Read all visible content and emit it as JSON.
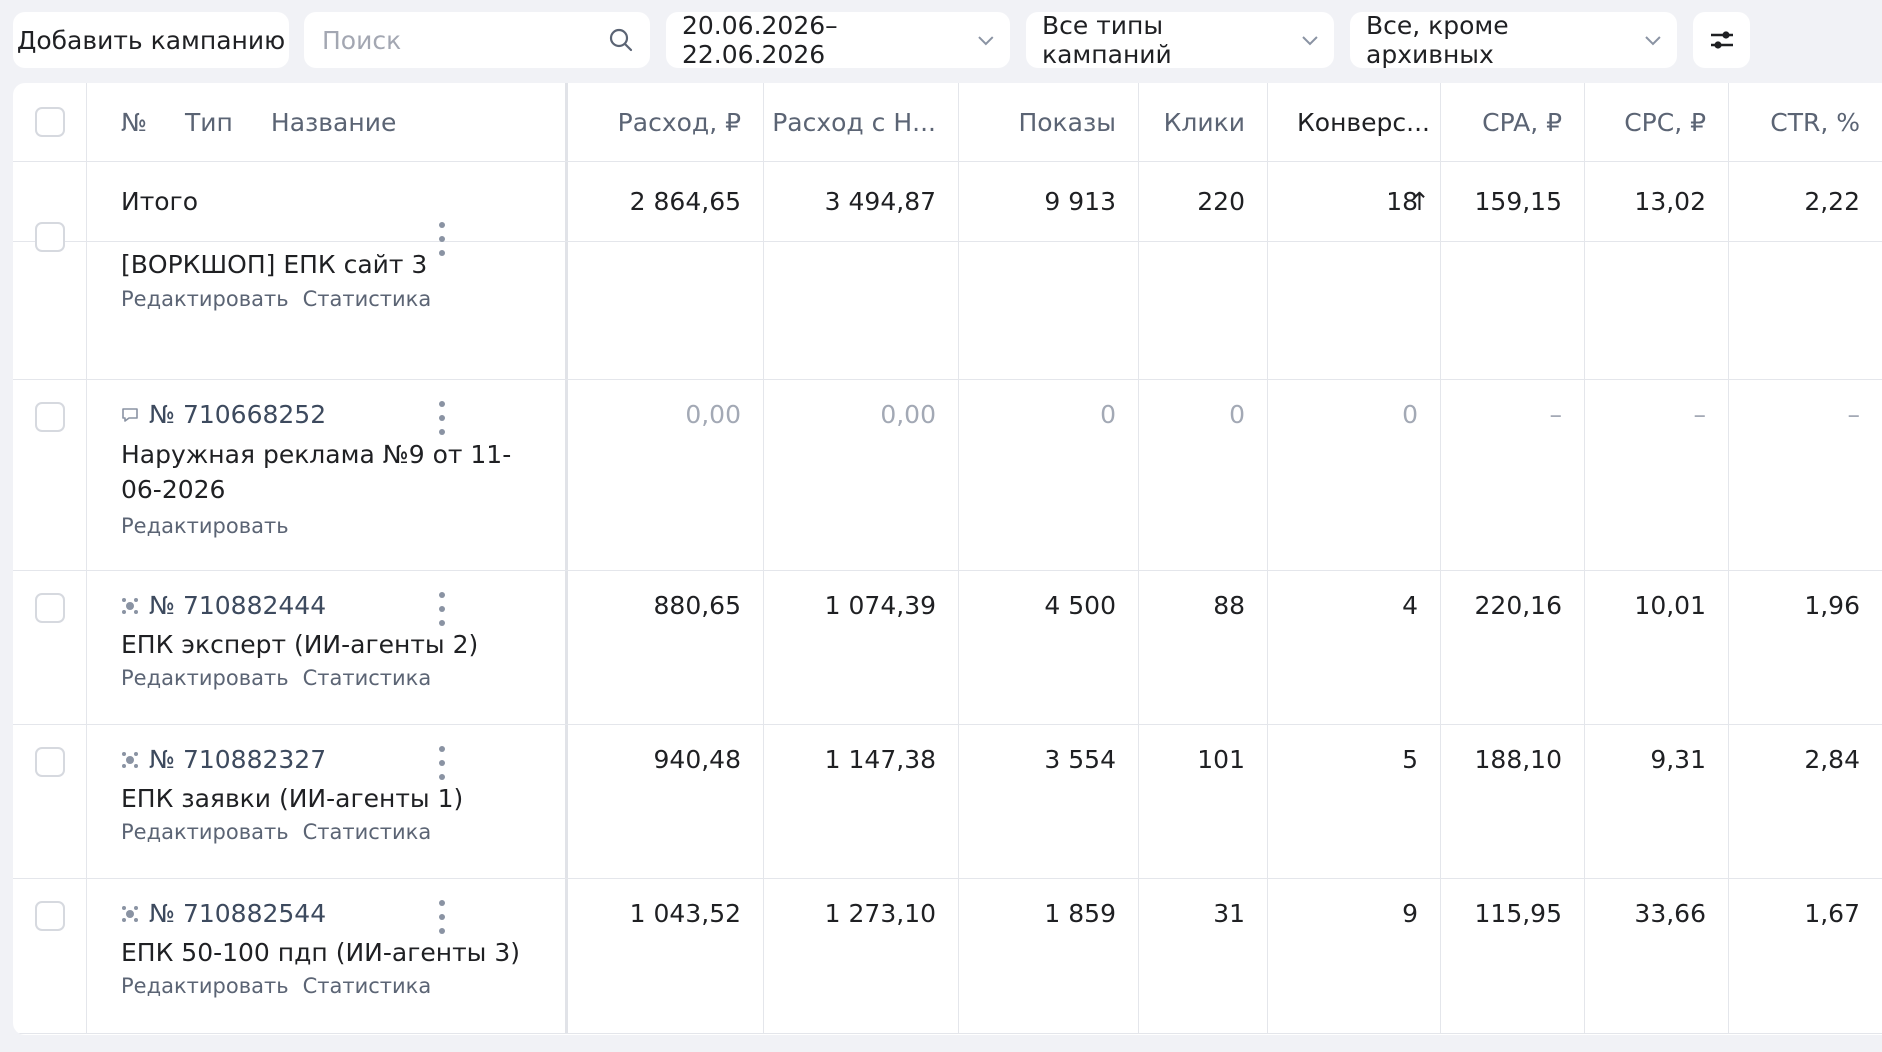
{
  "toolbar": {
    "add_campaign": "Добавить кампанию",
    "search_placeholder": "Поиск",
    "date_range": "20.06.2026–22.06.2026",
    "campaign_types": "Все типы кампаний",
    "archive_filter": "Все, кроме архивных"
  },
  "header": {
    "num": "№",
    "type": "Тип",
    "name": "Название",
    "spend": "Расход, ₽",
    "spend_vat": "Расход с Н...",
    "impressions": "Показы",
    "clicks": "Клики",
    "conversions": "Конверс...",
    "sort_arrow": "↑",
    "cpa": "CPA, ₽",
    "cpc": "CPC, ₽",
    "ctr": "CTR, %"
  },
  "total": {
    "label": "Итого",
    "spend": "2 864,65",
    "spend_vat": "3 494,87",
    "impressions": "9 913",
    "clicks": "220",
    "conversions": "18",
    "cpa": "159,15",
    "cpc": "13,02",
    "ctr": "2,22"
  },
  "rows": [
    {
      "name": "[ВОРКШОП] ЕПК сайт 3",
      "edit": "Редактировать",
      "stats": "Статистика"
    },
    {
      "id": "№ 710668252",
      "icon": "message-icon",
      "name": "Наружная реклама №9 от 11-06-2026",
      "edit": "Редактировать",
      "spend": "0,00",
      "spend_vat": "0,00",
      "impressions": "0",
      "clicks": "0",
      "conversions": "0",
      "cpa": "–",
      "cpc": "–",
      "ctr": "–"
    },
    {
      "id": "№ 710882444",
      "icon": "unified-campaign-icon",
      "name": "ЕПК эксперт (ИИ-агенты 2)",
      "edit": "Редактировать",
      "stats": "Статистика",
      "spend": "880,65",
      "spend_vat": "1 074,39",
      "impressions": "4 500",
      "clicks": "88",
      "conversions": "4",
      "cpa": "220,16",
      "cpc": "10,01",
      "ctr": "1,96"
    },
    {
      "id": "№ 710882327",
      "icon": "unified-campaign-icon",
      "name": "ЕПК заявки (ИИ-агенты 1)",
      "edit": "Редактировать",
      "stats": "Статистика",
      "spend": "940,48",
      "spend_vat": "1 147,38",
      "impressions": "3 554",
      "clicks": "101",
      "conversions": "5",
      "cpa": "188,10",
      "cpc": "9,31",
      "ctr": "2,84"
    },
    {
      "id": "№ 710882544",
      "icon": "unified-campaign-icon",
      "name": "ЕПК 50-100 пдп (ИИ-агенты 3)",
      "edit": "Редактировать",
      "stats": "Статистика",
      "spend": "1 043,52",
      "spend_vat": "1 273,10",
      "impressions": "1 859",
      "clicks": "31",
      "conversions": "9",
      "cpa": "115,95",
      "cpc": "33,66",
      "ctr": "1,67"
    }
  ]
}
